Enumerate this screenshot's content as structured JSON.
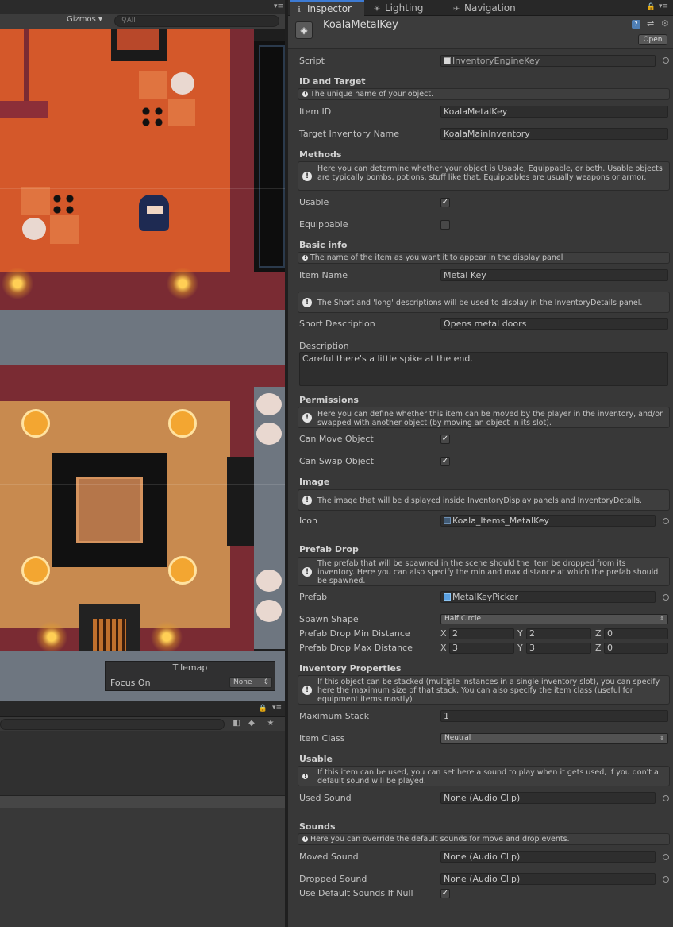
{
  "scene": {
    "gizmos_label": "Gizmos",
    "search_placeholder": "All",
    "tilemap_overlay": {
      "title": "Tilemap",
      "focus_label": "Focus On",
      "focus_value": "None"
    }
  },
  "inspector": {
    "tabs": [
      {
        "label": "Inspector",
        "icon": "info-icon"
      },
      {
        "label": "Lighting",
        "icon": "lighting-icon"
      },
      {
        "label": "Navigation",
        "icon": "navigation-icon"
      }
    ],
    "object_name": "KoalaMetalKey",
    "open_label": "Open",
    "script_label": "Script",
    "script_value": "InventoryEngineKey",
    "id_header": "ID and Target",
    "id_help": "The unique name of your object.",
    "item_id_label": "Item ID",
    "item_id_value": "KoalaMetalKey",
    "target_label": "Target Inventory Name",
    "target_value": "KoalaMainInventory",
    "methods_header": "Methods",
    "methods_help": "Here you can determine whether your object is Usable, Equippable, or both. Usable objects are typically bombs, potions, stuff like that. Equippables are usually weapons or armor.",
    "usable_label": "Usable",
    "usable_checked": true,
    "equippable_label": "Equippable",
    "equippable_checked": false,
    "basic_header": "Basic info",
    "basic_help": "The name of the item as you want it to appear in the display panel",
    "item_name_label": "Item Name",
    "item_name_value": "Metal Key",
    "desc_help": "The Short and 'long' descriptions will be used to display in the InventoryDetails panel.",
    "short_desc_label": "Short Description",
    "short_desc_value": "Opens metal doors",
    "desc_label": "Description",
    "desc_value": "Careful there's a little spike at the end.",
    "permissions_header": "Permissions",
    "permissions_help": "Here you can define whether this item can be moved by the player in the inventory, and/or swapped with another object (by moving an object in its slot).",
    "can_move_label": "Can Move Object",
    "can_move_checked": true,
    "can_swap_label": "Can Swap Object",
    "can_swap_checked": true,
    "image_header": "Image",
    "image_help": "The image that will be displayed inside InventoryDisplay panels and InventoryDetails.",
    "icon_label": "Icon",
    "icon_value": "Koala_Items_MetalKey",
    "prefab_header": "Prefab Drop",
    "prefab_help": "The prefab that will be spawned in the scene should the item be dropped from its inventory. Here you can also specify the min and max distance at which the prefab should be spawned.",
    "prefab_label": "Prefab",
    "prefab_value": "MetalKeyPicker",
    "spawn_shape_label": "Spawn Shape",
    "spawn_shape_value": "Half Circle",
    "min_dist_label": "Prefab Drop Min Distance",
    "min_dist": {
      "x": "2",
      "y": "2",
      "z": "0"
    },
    "max_dist_label": "Prefab Drop Max Distance",
    "max_dist": {
      "x": "3",
      "y": "3",
      "z": "0"
    },
    "axis_labels": {
      "x": "X",
      "y": "Y",
      "z": "Z"
    },
    "inventory_header": "Inventory Properties",
    "inventory_help": "If this object can be stacked (multiple instances in a single inventory slot), you can specify here the maximum size of that stack. You can also specify the item class (useful for equipment items mostly)",
    "max_stack_label": "Maximum Stack",
    "max_stack_value": "1",
    "item_class_label": "Item Class",
    "item_class_value": "Neutral",
    "usable_header": "Usable",
    "usable_help": "If this item can be used, you can set here a sound to play when it gets used, if you don't a default sound will be played.",
    "used_sound_label": "Used Sound",
    "used_sound_value": "None (Audio Clip)",
    "sounds_header": "Sounds",
    "sounds_help": "Here you can override the default sounds for move and drop events.",
    "moved_sound_label": "Moved Sound",
    "moved_sound_value": "None (Audio Clip)",
    "dropped_sound_label": "Dropped Sound",
    "dropped_sound_value": "None (Audio Clip)",
    "use_default_label": "Use Default Sounds If Null",
    "use_default_checked": true
  },
  "colors": {
    "accent": "#3d7bd4",
    "floor_orange": "#d4582a",
    "floor_tan": "#c88a4f",
    "wall": "#7a2b33",
    "stone": "#6e7680"
  }
}
